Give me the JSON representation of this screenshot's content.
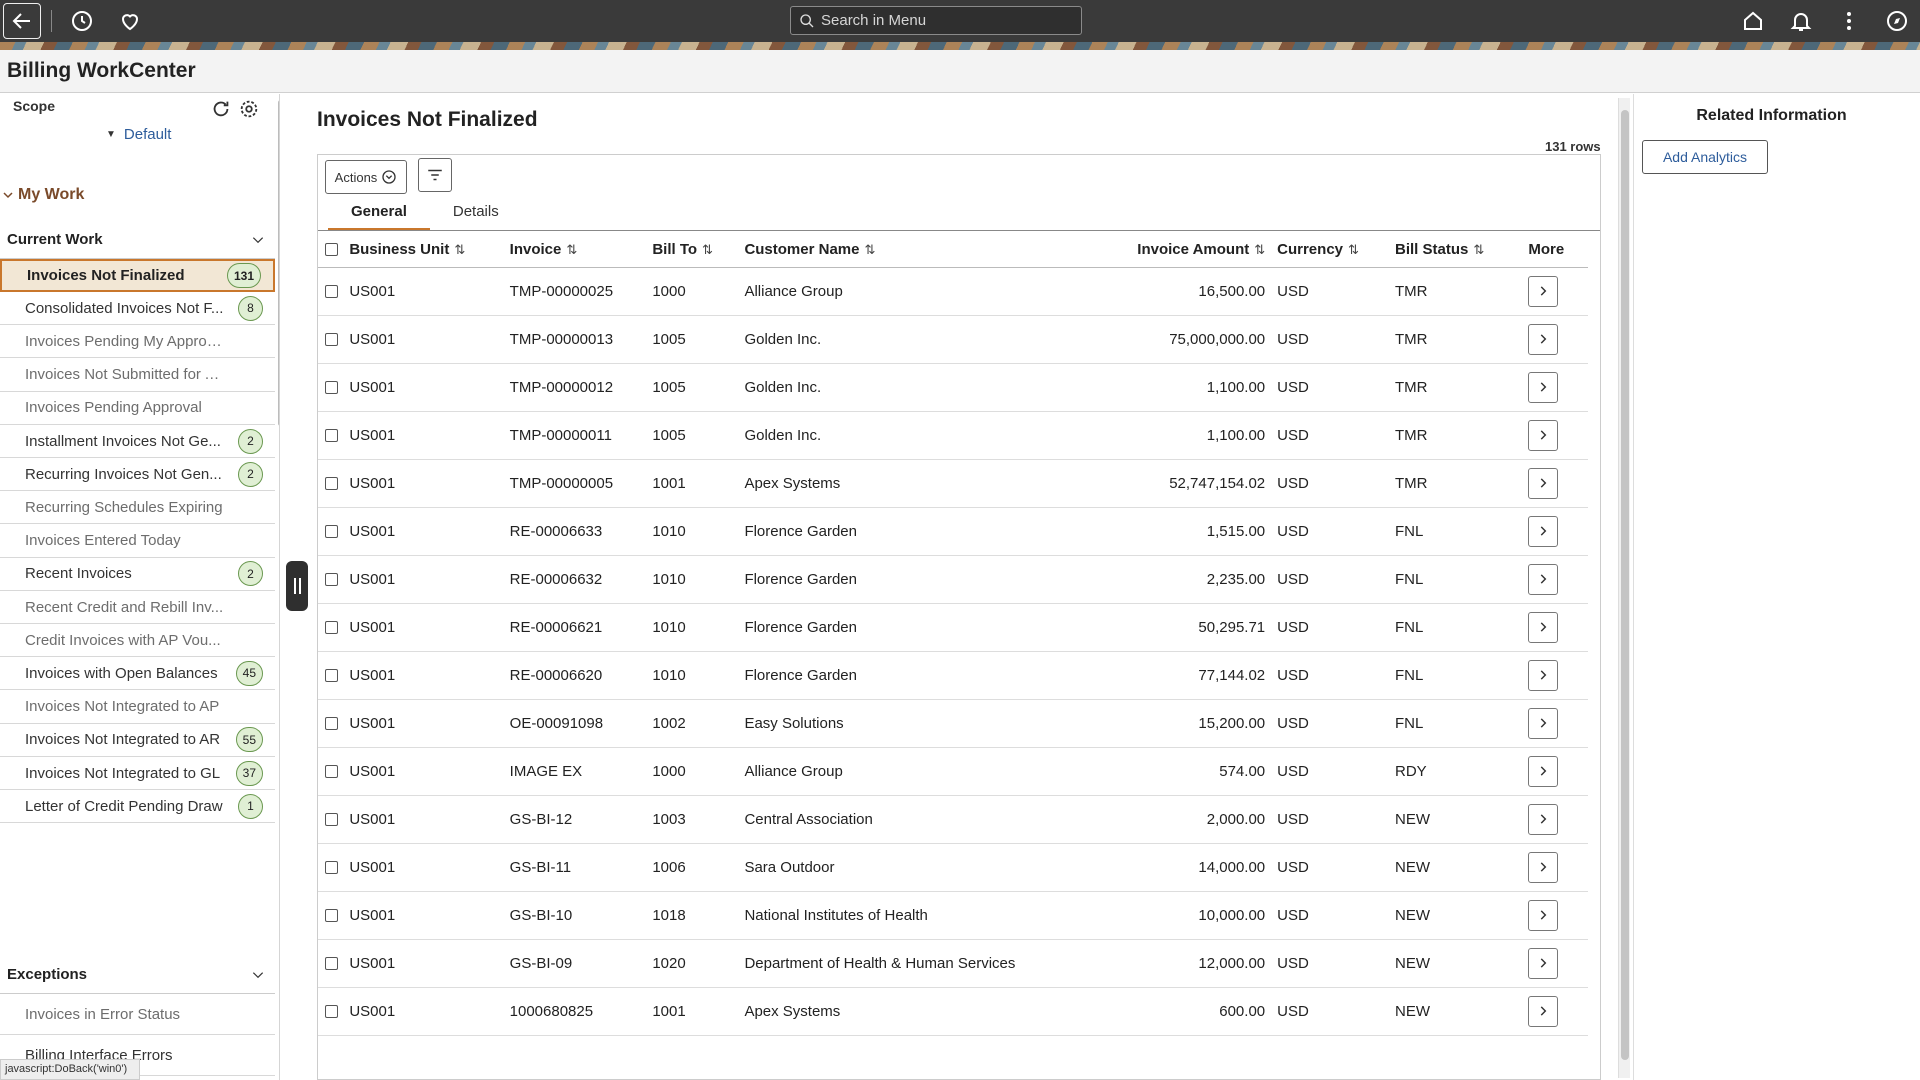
{
  "topbar": {
    "search_placeholder": "Search in Menu"
  },
  "page": {
    "title": "Billing WorkCenter"
  },
  "left": {
    "scope_label": "Scope",
    "scope_value": "Default",
    "my_work": "My Work",
    "current_work": "Current Work",
    "exceptions": "Exceptions",
    "items": [
      {
        "label": "Invoices Not Finalized",
        "badge": "131"
      },
      {
        "label": "Consolidated Invoices Not F...",
        "badge": "8"
      },
      {
        "label": "Invoices Pending My Approval",
        "badge": null
      },
      {
        "label": "Invoices Not Submitted for A...",
        "badge": null
      },
      {
        "label": "Invoices Pending Approval",
        "badge": null
      },
      {
        "label": "Installment Invoices Not Ge...",
        "badge": "2"
      },
      {
        "label": "Recurring Invoices Not Gen...",
        "badge": "2"
      },
      {
        "label": "Recurring Schedules Expiring",
        "badge": null
      },
      {
        "label": "Invoices Entered Today",
        "badge": null
      },
      {
        "label": "Recent Invoices",
        "badge": "2"
      },
      {
        "label": "Recent Credit and Rebill Inv...",
        "badge": null
      },
      {
        "label": "Credit Invoices with AP Vou...",
        "badge": null
      },
      {
        "label": "Invoices with Open Balances",
        "badge": "45"
      },
      {
        "label": "Invoices Not Integrated to AP",
        "badge": null
      },
      {
        "label": "Invoices Not Integrated to AR",
        "badge": "55"
      },
      {
        "label": "Invoices Not Integrated to GL",
        "badge": "37"
      },
      {
        "label": "Letter of Credit Pending Draw",
        "badge": "1"
      }
    ],
    "exception_items": [
      {
        "label": "Invoices in Error Status"
      },
      {
        "label": "Billing Interface Errors"
      }
    ],
    "status_url": "javascript:DoBack('win0')"
  },
  "main": {
    "title": "Invoices Not Finalized",
    "row_count": "131 rows",
    "actions_label": "Actions",
    "tabs": [
      "General",
      "Details"
    ],
    "columns": [
      "Business Unit",
      "Invoice",
      "Bill To",
      "Customer Name",
      "Invoice Amount",
      "Currency",
      "Bill Status",
      "More"
    ],
    "rows": [
      [
        "US001",
        "TMP-00000025",
        "1000",
        "Alliance Group",
        "16,500.00",
        "USD",
        "TMR"
      ],
      [
        "US001",
        "TMP-00000013",
        "1005",
        "Golden Inc.",
        "75,000,000.00",
        "USD",
        "TMR"
      ],
      [
        "US001",
        "TMP-00000012",
        "1005",
        "Golden Inc.",
        "1,100.00",
        "USD",
        "TMR"
      ],
      [
        "US001",
        "TMP-00000011",
        "1005",
        "Golden Inc.",
        "1,100.00",
        "USD",
        "TMR"
      ],
      [
        "US001",
        "TMP-00000005",
        "1001",
        "Apex Systems",
        "52,747,154.02",
        "USD",
        "TMR"
      ],
      [
        "US001",
        "RE-00006633",
        "1010",
        "Florence Garden",
        "1,515.00",
        "USD",
        "FNL"
      ],
      [
        "US001",
        "RE-00006632",
        "1010",
        "Florence Garden",
        "2,235.00",
        "USD",
        "FNL"
      ],
      [
        "US001",
        "RE-00006621",
        "1010",
        "Florence Garden",
        "50,295.71",
        "USD",
        "FNL"
      ],
      [
        "US001",
        "RE-00006620",
        "1010",
        "Florence Garden",
        "77,144.02",
        "USD",
        "FNL"
      ],
      [
        "US001",
        "OE-00091098",
        "1002",
        "Easy Solutions",
        "15,200.00",
        "USD",
        "FNL"
      ],
      [
        "US001",
        "IMAGE EX",
        "1000",
        "Alliance Group",
        "574.00",
        "USD",
        "RDY"
      ],
      [
        "US001",
        "GS-BI-12",
        "1003",
        "Central Association",
        "2,000.00",
        "USD",
        "NEW"
      ],
      [
        "US001",
        "GS-BI-11",
        "1006",
        "Sara Outdoor",
        "14,000.00",
        "USD",
        "NEW"
      ],
      [
        "US001",
        "GS-BI-10",
        "1018",
        "National Institutes of Health",
        "10,000.00",
        "USD",
        "NEW"
      ],
      [
        "US001",
        "GS-BI-09",
        "1020",
        "Department of Health & Human Services",
        "12,000.00",
        "USD",
        "NEW"
      ],
      [
        "US001",
        "1000680825",
        "1001",
        "Apex Systems",
        "600.00",
        "USD",
        "NEW"
      ]
    ]
  },
  "right": {
    "title": "Related Information",
    "add_analytics": "Add Analytics"
  },
  "colors": {
    "accent": "#c9772c",
    "link": "#2d5c9b",
    "topbar": "#3a3a3a",
    "badge": "#e0efd4"
  }
}
